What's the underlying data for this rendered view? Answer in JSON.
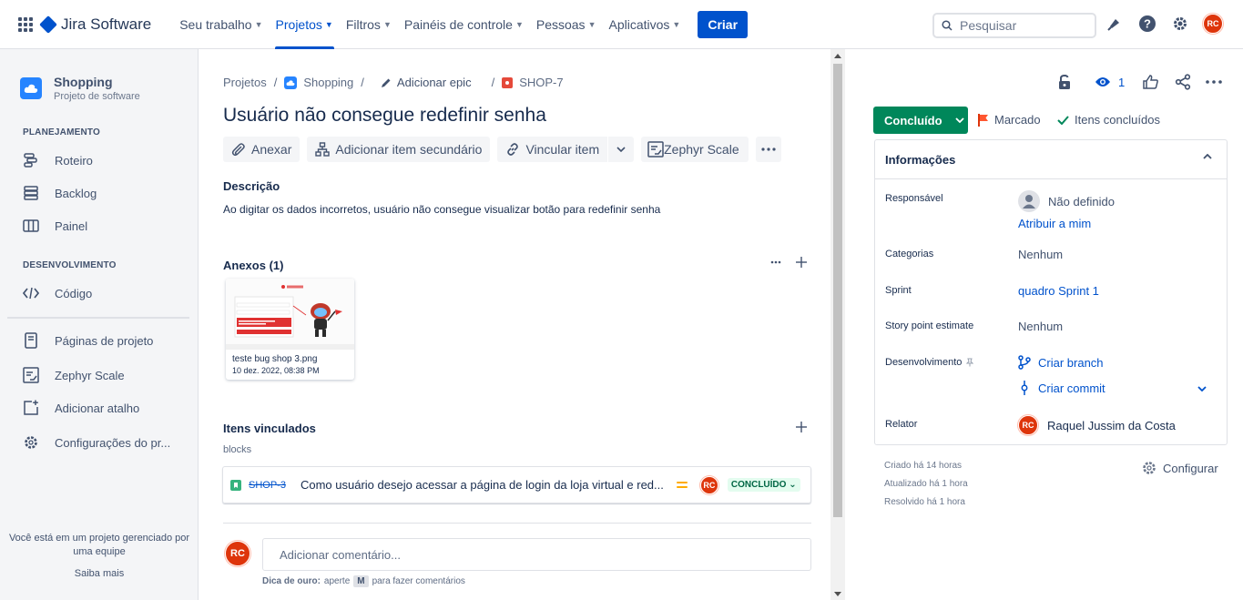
{
  "topnav": {
    "logo": "Jira Software",
    "items": [
      {
        "label": "Seu trabalho"
      },
      {
        "label": "Projetos"
      },
      {
        "label": "Filtros"
      },
      {
        "label": "Painéis de controle"
      },
      {
        "label": "Pessoas"
      },
      {
        "label": "Aplicativos"
      }
    ],
    "create": "Criar",
    "search_placeholder": "Pesquisar",
    "avatar": "RC"
  },
  "sidebar": {
    "project_name": "Shopping",
    "project_type": "Projeto de software",
    "planning_title": "PLANEJAMENTO",
    "planning": [
      {
        "label": "Roteiro"
      },
      {
        "label": "Backlog"
      },
      {
        "label": "Painel"
      }
    ],
    "dev_title": "DESENVOLVIMENTO",
    "dev": [
      {
        "label": "Código"
      }
    ],
    "bottom": [
      {
        "label": "Páginas de projeto"
      },
      {
        "label": "Zephyr Scale"
      },
      {
        "label": "Adicionar atalho"
      },
      {
        "label": "Configurações do pr..."
      }
    ],
    "footer_text": "Você está em um projeto gerenciado por uma equipe",
    "footer_link": "Saiba mais"
  },
  "issue": {
    "breadcrumbs": {
      "projects": "Projetos",
      "project": "Shopping",
      "epic": "Adicionar epic",
      "key": "SHOP-7"
    },
    "title": "Usuário não consegue redefinir senha",
    "actions": {
      "attach": "Anexar",
      "child": "Adicionar item secundário",
      "link": "Vincular item",
      "zephyr": "Zephyr Scale"
    },
    "description_label": "Descrição",
    "description": "Ao digitar os dados incorretos, usuário não consegue visualizar botão para redefinir senha",
    "attachments_label": "Anexos (1)",
    "attachment": {
      "name": "teste bug shop 3.png",
      "date": "10 dez. 2022, 08:38 PM"
    },
    "linked_label": "Itens vinculados",
    "link_type": "blocks",
    "linked": {
      "key": "SHOP-3",
      "summary": "Como usuário desejo acessar a página de login da loja virtual e red...",
      "avatar": "RC",
      "status": "CONCLUÍDO"
    },
    "comment": {
      "avatar": "RC",
      "placeholder": "Adicionar comentário...",
      "tip_bold": "Dica de ouro:",
      "tip_pre": "aperte",
      "tip_key": "M",
      "tip_post": "para fazer comentários"
    }
  },
  "details": {
    "watch_count": "1",
    "status": "Concluído",
    "flag": "Marcado",
    "done_items": "Itens concluídos",
    "info_title": "Informações",
    "fields": {
      "assignee_label": "Responsável",
      "assignee": "Não definido",
      "assign_me": "Atribuir a mim",
      "labels_label": "Categorias",
      "labels": "Nenhum",
      "sprint_label": "Sprint",
      "sprint": "quadro Sprint 1",
      "points_label": "Story point estimate",
      "points": "Nenhum",
      "dev_label": "Desenvolvimento",
      "branch": "Criar branch",
      "commit": "Criar commit",
      "reporter_label": "Relator",
      "reporter_avatar": "RC",
      "reporter": "Raquel Jussim da Costa"
    },
    "created": "Criado há 14 horas",
    "updated": "Atualizado há 1 hora",
    "resolved": "Resolvido há 1 hora",
    "configure": "Configurar"
  }
}
